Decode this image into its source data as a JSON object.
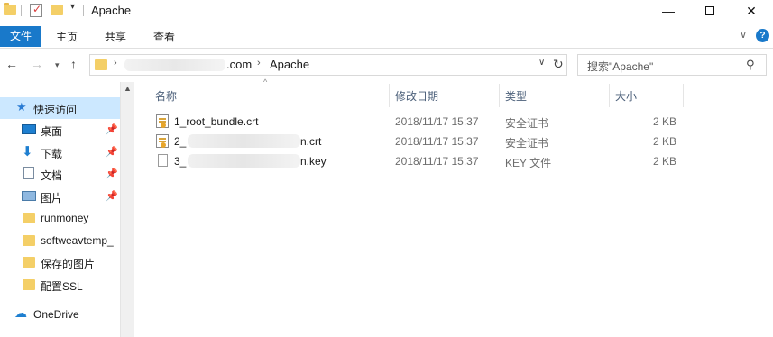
{
  "window": {
    "title": "Apache",
    "controls": {
      "minimize": "—",
      "maximize": "",
      "close": "✕"
    }
  },
  "ribbon": {
    "tabs": [
      "文件",
      "主页",
      "共享",
      "查看"
    ]
  },
  "navigation": {
    "address_segments": [
      ".com",
      "Apache"
    ],
    "search_placeholder": "搜索\"Apache\""
  },
  "sidebar": {
    "items": [
      {
        "label": "快速访问",
        "icon": "star-icon",
        "pinned": false
      },
      {
        "label": "桌面",
        "icon": "desktop-icon",
        "pinned": true
      },
      {
        "label": "下载",
        "icon": "download-icon",
        "pinned": true
      },
      {
        "label": "文档",
        "icon": "document-icon",
        "pinned": true
      },
      {
        "label": "图片",
        "icon": "picture-icon",
        "pinned": true
      },
      {
        "label": "runmoney",
        "icon": "folder-icon",
        "pinned": false
      },
      {
        "label": "softweavtemp_",
        "icon": "folder-icon",
        "pinned": false
      },
      {
        "label": "保存的图片",
        "icon": "folder-icon",
        "pinned": false
      },
      {
        "label": "配置SSL",
        "icon": "folder-icon",
        "pinned": false
      },
      {
        "label": "OneDrive",
        "icon": "onedrive-icon",
        "pinned": false
      }
    ]
  },
  "file_list": {
    "columns": [
      "名称",
      "修改日期",
      "类型",
      "大小"
    ],
    "rows": [
      {
        "prefix": "1_root_bundle.crt",
        "suffix": "",
        "date": "2018/11/17 15:37",
        "type": "安全证书",
        "size": "2 KB",
        "icon": "certificate-icon"
      },
      {
        "prefix": "2_",
        "suffix": "n.crt",
        "date": "2018/11/17 15:37",
        "type": "安全证书",
        "size": "2 KB",
        "icon": "certificate-icon"
      },
      {
        "prefix": "3_",
        "suffix": "n.key",
        "date": "2018/11/17 15:37",
        "type": "KEY 文件",
        "size": "2 KB",
        "icon": "file-icon"
      }
    ]
  },
  "colors": {
    "accent": "#1979ca",
    "selection": "#cce8ff",
    "folder": "#f4cf67"
  }
}
